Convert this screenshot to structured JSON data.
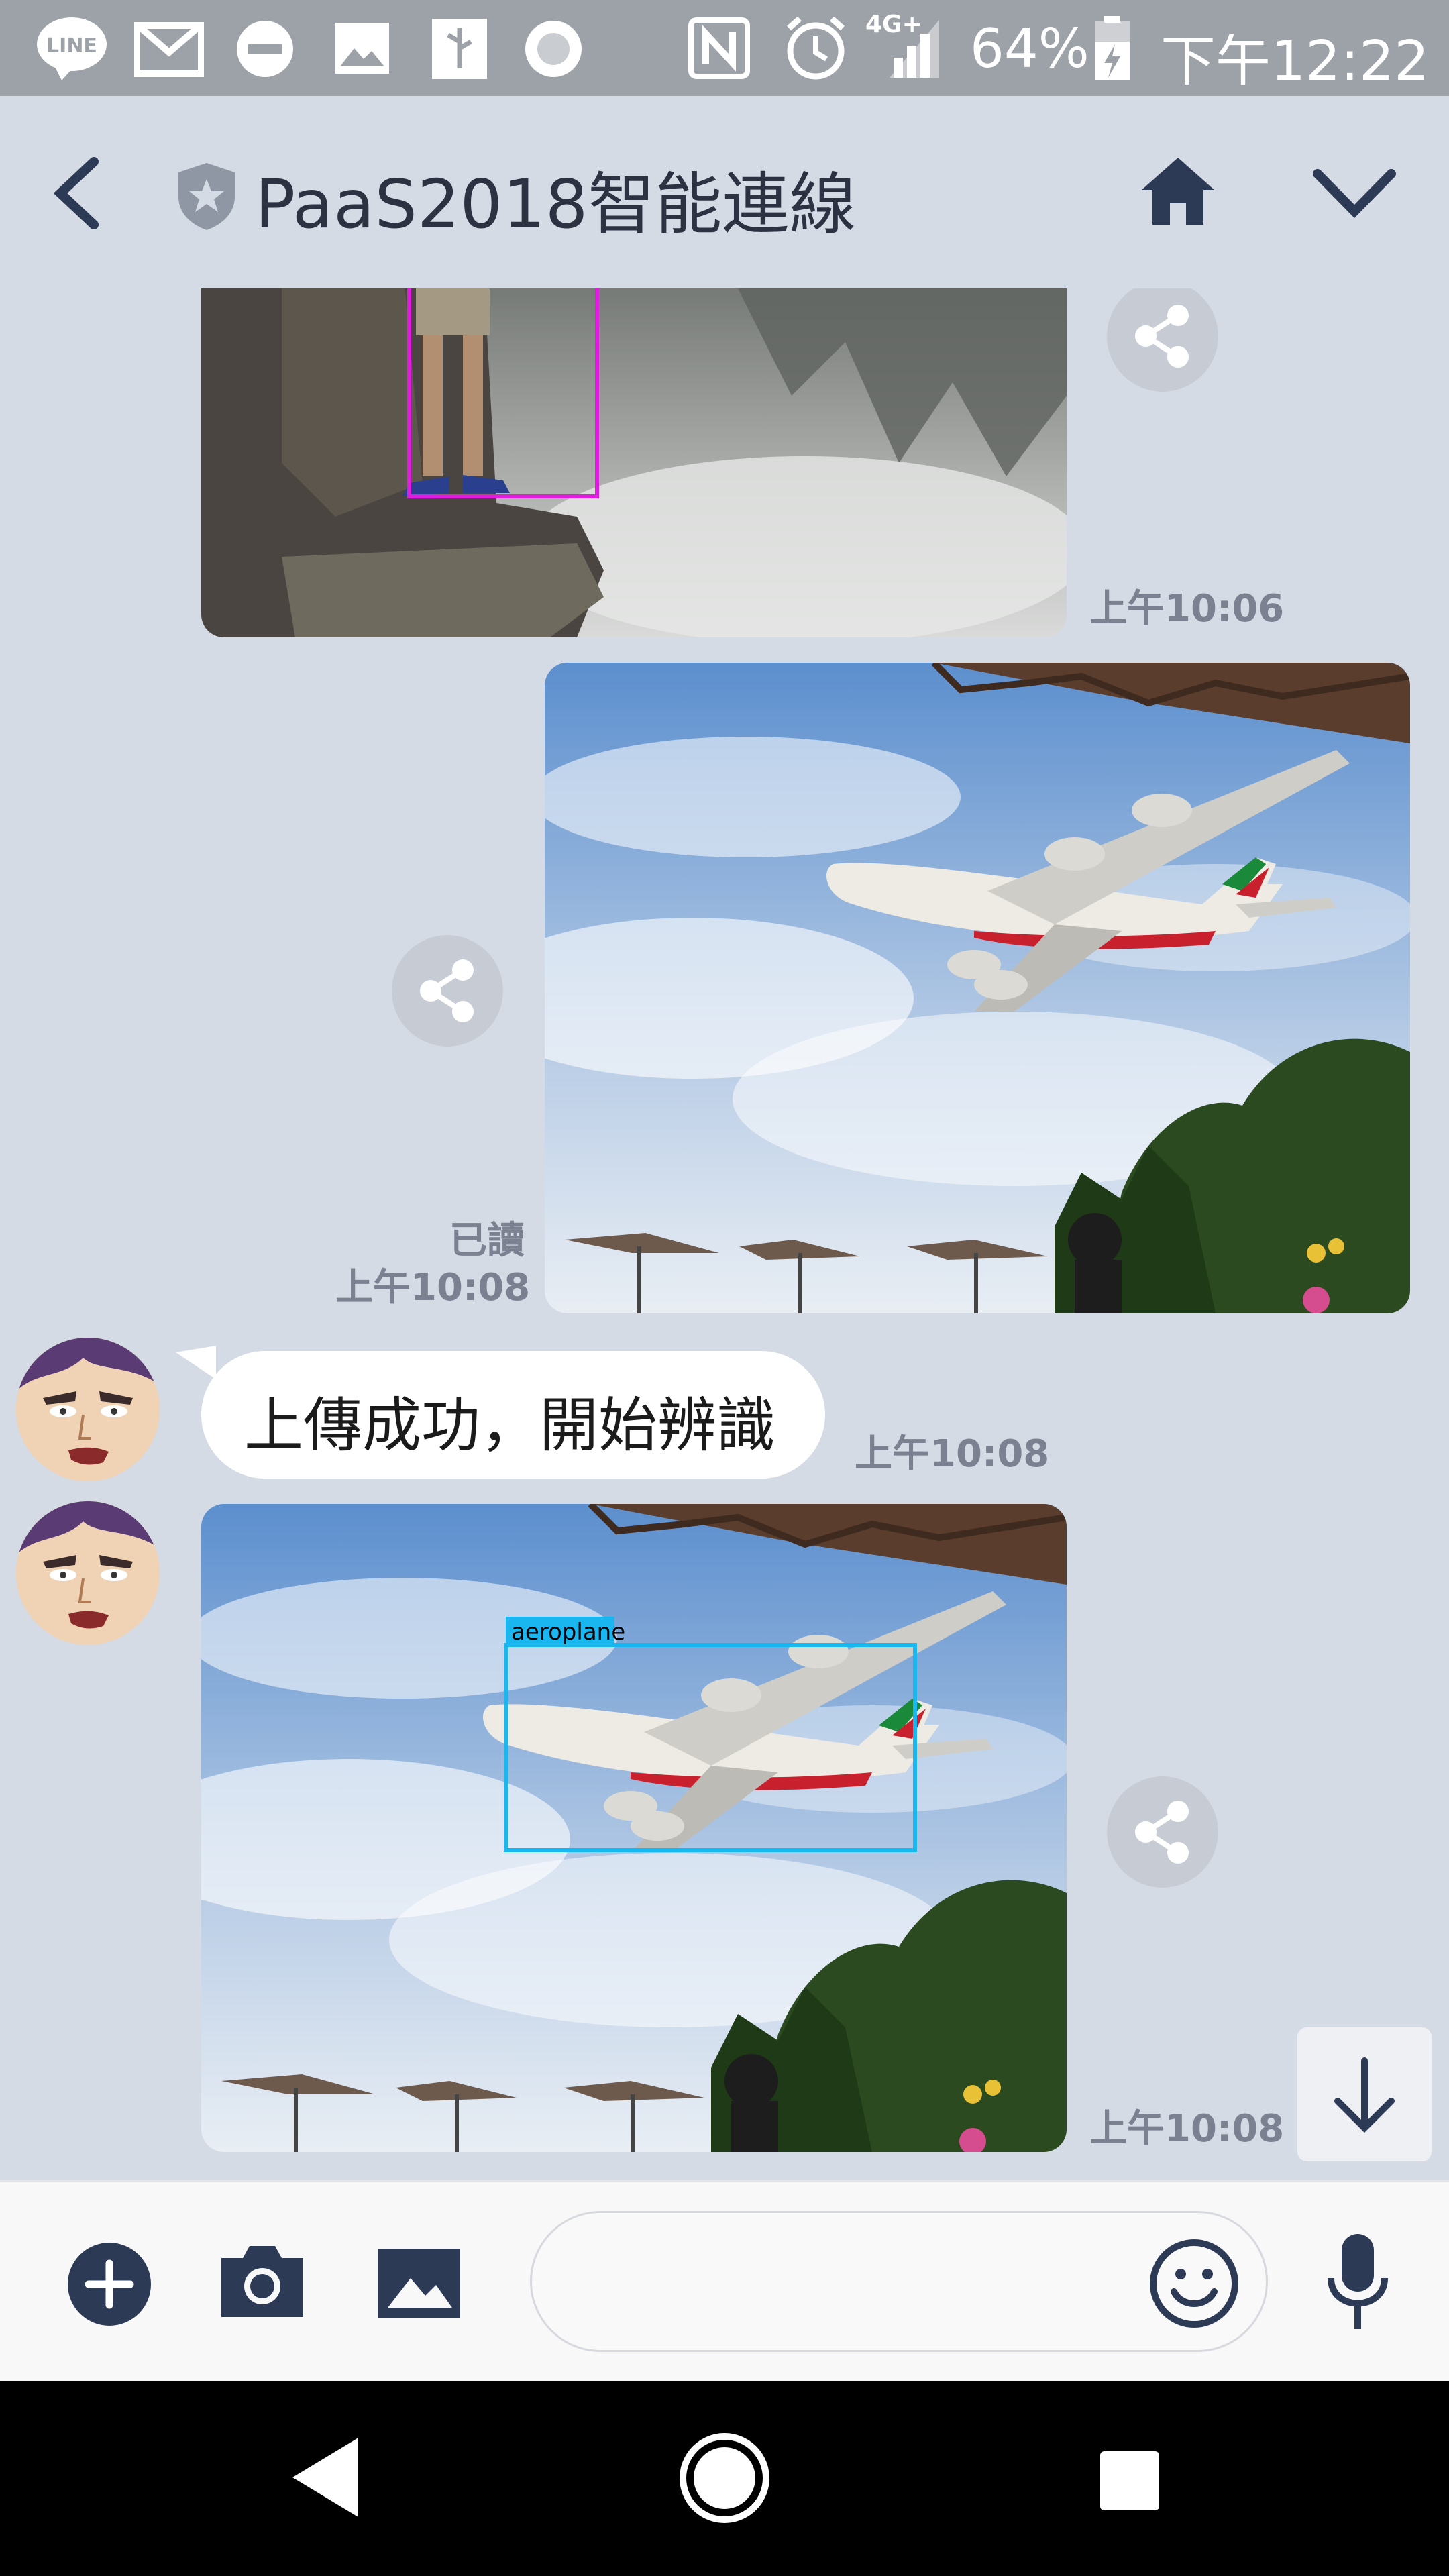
{
  "status_bar": {
    "line_badge": "LINE",
    "battery": "64%",
    "network": "4G+",
    "time": "下午12:22"
  },
  "header": {
    "title": "PaaS2018智能連線"
  },
  "messages": [
    {
      "type": "image",
      "sender": "bot",
      "time": "上午10:06"
    },
    {
      "type": "image",
      "sender": "me",
      "read": "已讀",
      "time": "上午10:08"
    },
    {
      "type": "text",
      "sender": "bot",
      "text": "上傳成功，開始辨識",
      "time": "上午10:08"
    },
    {
      "type": "image",
      "sender": "bot",
      "time": "上午10:08",
      "detection_label": "aeroplane"
    }
  ],
  "input": {
    "placeholder": ""
  },
  "colors": {
    "status_bar": "#9da1a8",
    "background": "#d5dbe5",
    "icon": "#2c3a55",
    "detection_box": "#19b6f0",
    "person_box": "#e21be0"
  },
  "icons": [
    "back-icon",
    "shield-star-icon",
    "home-icon",
    "chevron-down-icon",
    "share-icon",
    "plus-icon",
    "camera-icon",
    "gallery-icon",
    "emoji-icon",
    "mic-icon",
    "arrow-down-icon",
    "nav-back-icon",
    "nav-home-icon",
    "nav-recents-icon"
  ]
}
